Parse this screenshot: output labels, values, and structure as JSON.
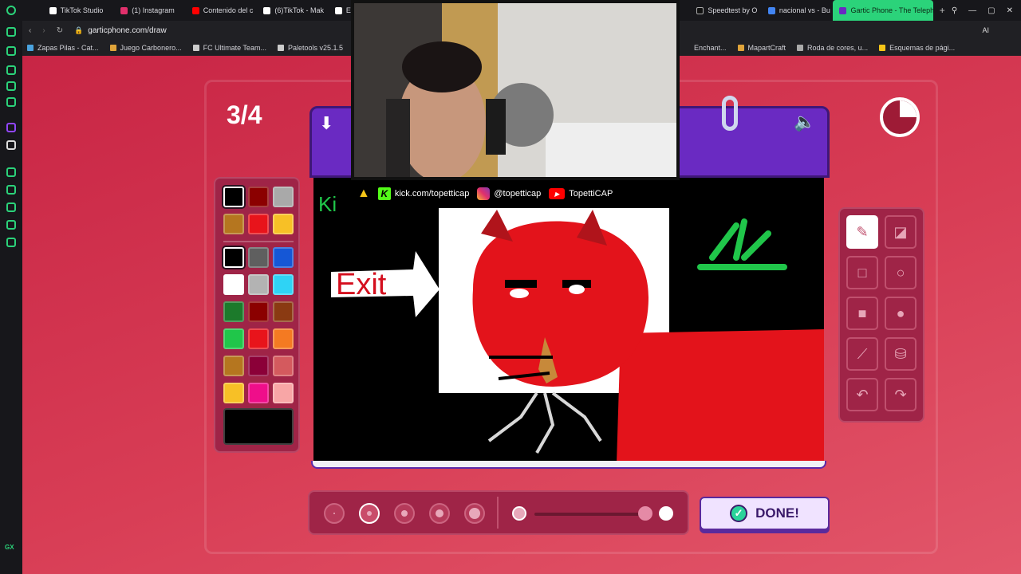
{
  "browser": {
    "tabs": [
      {
        "label": "TikTok Studio"
      },
      {
        "label": "(1) Instagram"
      },
      {
        "label": "Contenido del c"
      },
      {
        "label": "(6)TikTok - Mak"
      },
      {
        "label": "El"
      },
      {
        "label": "Speedtest by O"
      },
      {
        "label": "nacional vs - Bu"
      },
      {
        "label": "Gartic Phone - The Teleph"
      }
    ],
    "url": "garticphone.com/draw",
    "bookmarks": [
      {
        "label": "Zapas Pilas - Cat..."
      },
      {
        "label": "Juego Carbonero..."
      },
      {
        "label": "FC Ultimate Team..."
      },
      {
        "label": "Paletools v25.1.5"
      },
      {
        "label": "Enchant..."
      },
      {
        "label": "MapartCraft"
      },
      {
        "label": "Roda de cores, u..."
      },
      {
        "label": "Esquemas de pági..."
      }
    ],
    "address_right_label": "AI"
  },
  "game": {
    "round_counter": "3/4",
    "timer_remaining_fraction": 0.25,
    "done_label": "DONE!",
    "selected_color": "#000000",
    "palette_top": [
      "#000000",
      "#8b0000",
      "#a9a9a9",
      "#b5761f",
      "#e8141b",
      "#f7c026"
    ],
    "palette_main": [
      "#000000",
      "#5f5f5f",
      "#1557d6",
      "#ffffff",
      "#b3b3b3",
      "#2fd3f5",
      "#1c7a2b",
      "#8b0000",
      "#8a3a12",
      "#20c64a",
      "#e8141b",
      "#f47a22",
      "#b5761f",
      "#8b0038",
      "#d45a5e",
      "#f7c026",
      "#ef0e8a",
      "#f8a6a6"
    ],
    "tools": [
      "pencil-icon",
      "eraser-icon",
      "rectangle-outline-icon",
      "circle-outline-icon",
      "rectangle-fill-icon",
      "circle-fill-icon",
      "line-icon",
      "bucket-icon",
      "undo-icon",
      "redo-icon"
    ],
    "brush_sizes_selected_index": 1,
    "opacity_level": 1.0,
    "drawing_text": "Exit",
    "drawing_corner_text": "Ki"
  },
  "stream_overlay": {
    "kick": "kick.com/topetticap",
    "instagram": "@topetticap",
    "youtube": "TopettiCAP"
  },
  "left_sidebar_label": "GX"
}
